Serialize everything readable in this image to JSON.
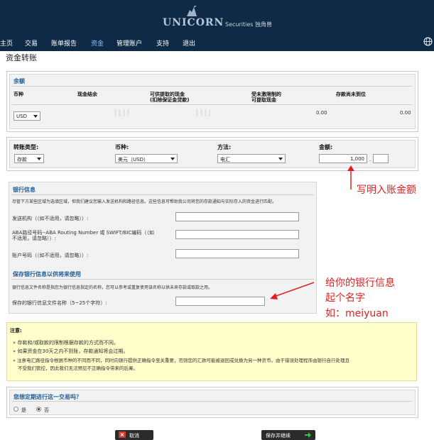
{
  "header": {
    "logo_main": "UNICORN",
    "logo_sub": "Securities 独角兽",
    "nav": [
      "主页",
      "交易",
      "账单报告",
      "资金",
      "管理账户",
      "支持",
      "退出"
    ],
    "active_nav": "资金"
  },
  "page_title": "资金转账",
  "balance": {
    "title": "余额",
    "headers": {
      "currency": "币种",
      "cash": "现金结余",
      "withdrawable_line1": "可供提取的现金",
      "withdrawable_line2": "(扣除保证金贷款)",
      "restricted_line1": "受未激限制的",
      "restricted_line2": "可提取现金",
      "uncleared": "存款尚未到位"
    },
    "currency_value": "USD",
    "restricted_value": "0.00",
    "uncleared_value": "0.00"
  },
  "transfer": {
    "type_label": "转账类型:",
    "type_value": "存款",
    "currency_label": "币种:",
    "currency_value": "美元（USD）",
    "method_label": "方法:",
    "method_value": "电汇",
    "amount_label": "金额:",
    "amount_value": "1,000",
    "amount_sep": ".",
    "amount_cents": ""
  },
  "bank_info": {
    "title": "银行信息",
    "desc": "尽管下方某些区域为选填区域，但我们建议您输入发送机构和路径信息。这些信息可帮助我公司将您的存款通知与实际存入的资金进行匹配。",
    "sender_label": "发送机构（（如不适用，请忽略））:",
    "aba_label1": "ABA路径号码--ABA Routing Number 或 SWIFT/BIC编码（（如",
    "aba_label2": "不适用，请忽略））:",
    "account_label": "账户号码（（如不适用，请忽略））:",
    "save_title": "保存银行信息以供将来使用",
    "save_desc": "银行信息文件名称是指您为银行信息指定的名称，您可以参考或重复使用该名称以供未来存款或取款之用。",
    "save_name_label": "保存的银行信息文件名称（5~25个字符）:"
  },
  "annotations": {
    "amount": "写明入账金额",
    "name_line1": "给你的银行信息",
    "name_line2": "起个名字",
    "name_line3": "如：meiyuan"
  },
  "note": {
    "title": "注意:",
    "items": [
      "存款和/或取款的限制根据存款的方式而不同。",
      "如果资金在30天之内不到账，存款通知将会过期。",
      "注意电汇路径指令根据币种的不同而不同，同时向银行提供正确指令至关重要，否则您的汇款可能被退回或兑换为另一种货币。由于错误处理程序由银行自行处理且",
      "不受我们管控，因此我们无法预见不正确指令带来的后果。"
    ]
  },
  "recurring": {
    "question": "您想定期进行这一交易吗？",
    "yes": "是",
    "no": "否",
    "selected": "否"
  },
  "buttons": {
    "cancel": "取消",
    "save_continue": "保存并继续"
  },
  "colors": {
    "header_bg": "#0f2a46",
    "section_title": "#1f5d99",
    "annotation": "#e02020",
    "note_bg": "#ffffcc"
  }
}
